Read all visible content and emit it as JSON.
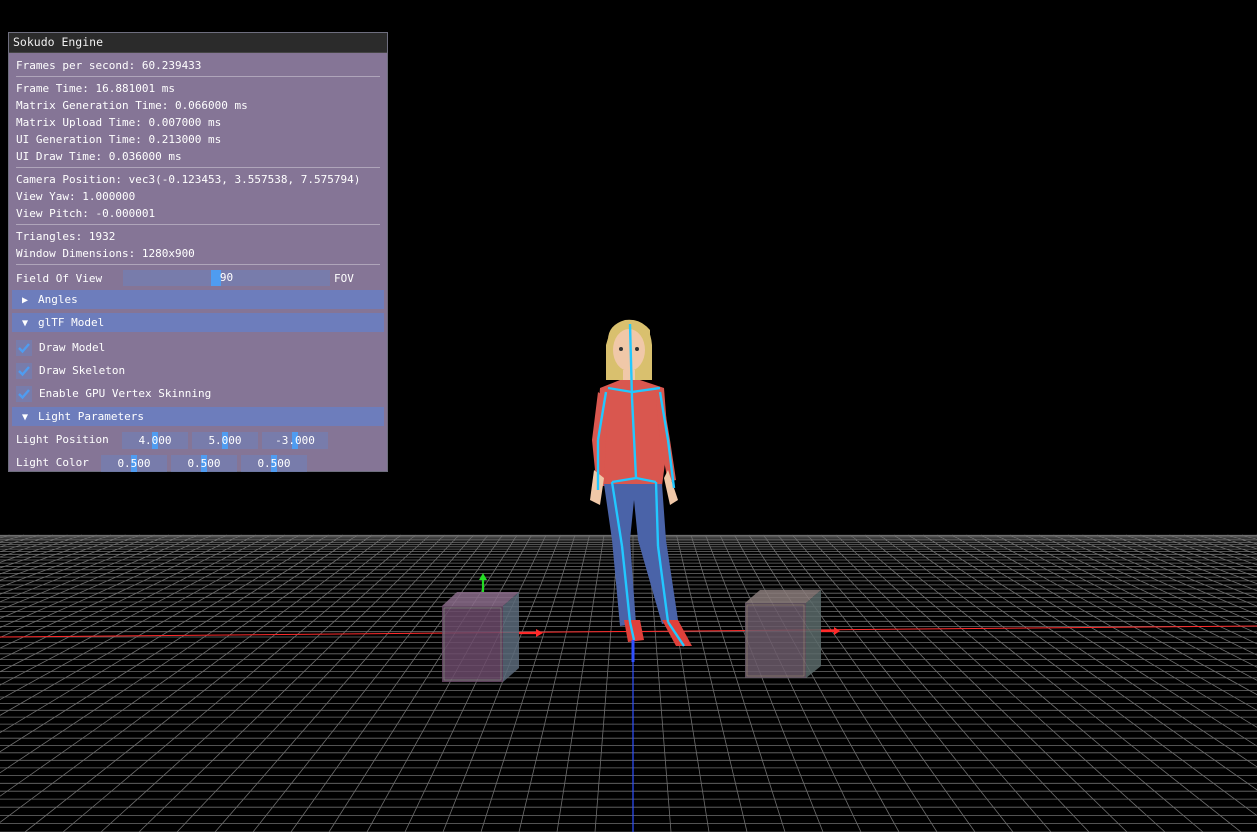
{
  "window": {
    "title": "Sokudo Engine"
  },
  "stats": {
    "fps": "Frames per second: 60.239433",
    "frame_time": "Frame Time: 16.881001 ms",
    "matrix_gen": "Matrix Generation Time: 0.066000 ms",
    "matrix_upload": "Matrix Upload Time: 0.007000 ms",
    "ui_gen": "UI Generation Time: 0.213000 ms",
    "ui_draw": "UI Draw Time: 0.036000 ms",
    "camera_pos": "Camera Position: vec3(-0.123453, 3.557538, 7.575794)",
    "view_yaw": "View Yaw: 1.000000",
    "view_pitch": "View Pitch: -0.000001",
    "triangles": "Triangles: 1932",
    "window_dims": "Window Dimensions: 1280x900"
  },
  "fov": {
    "label": "Field Of View",
    "value": "90",
    "suffix": "FOV",
    "fraction": 0.5
  },
  "sections": {
    "angles": {
      "label": "Angles",
      "expanded": false
    },
    "gltf": {
      "label": "glTF Model",
      "expanded": true
    },
    "light": {
      "label": "Light Parameters",
      "expanded": true
    }
  },
  "checkboxes": {
    "draw_model": {
      "label": "Draw Model",
      "checked": true
    },
    "draw_skeleton": {
      "label": "Draw Skeleton",
      "checked": true
    },
    "gpu_skinning": {
      "label": "Enable GPU Vertex Skinning",
      "checked": true
    }
  },
  "light": {
    "position_label": "Light Position",
    "position": [
      "4.000",
      "5.000",
      "-3.000"
    ],
    "color_label": "Light Color",
    "color": [
      "0.500",
      "0.500",
      "0.500"
    ]
  },
  "colors": {
    "panel_bg": "#ab96c0",
    "header_bg": "#6680c8",
    "accent": "#4f9cf0",
    "grid": "#8a8a8a",
    "x_axis": "#ff2a2a",
    "z_axis": "#2a2aff",
    "y_axis": "#22dd22"
  }
}
